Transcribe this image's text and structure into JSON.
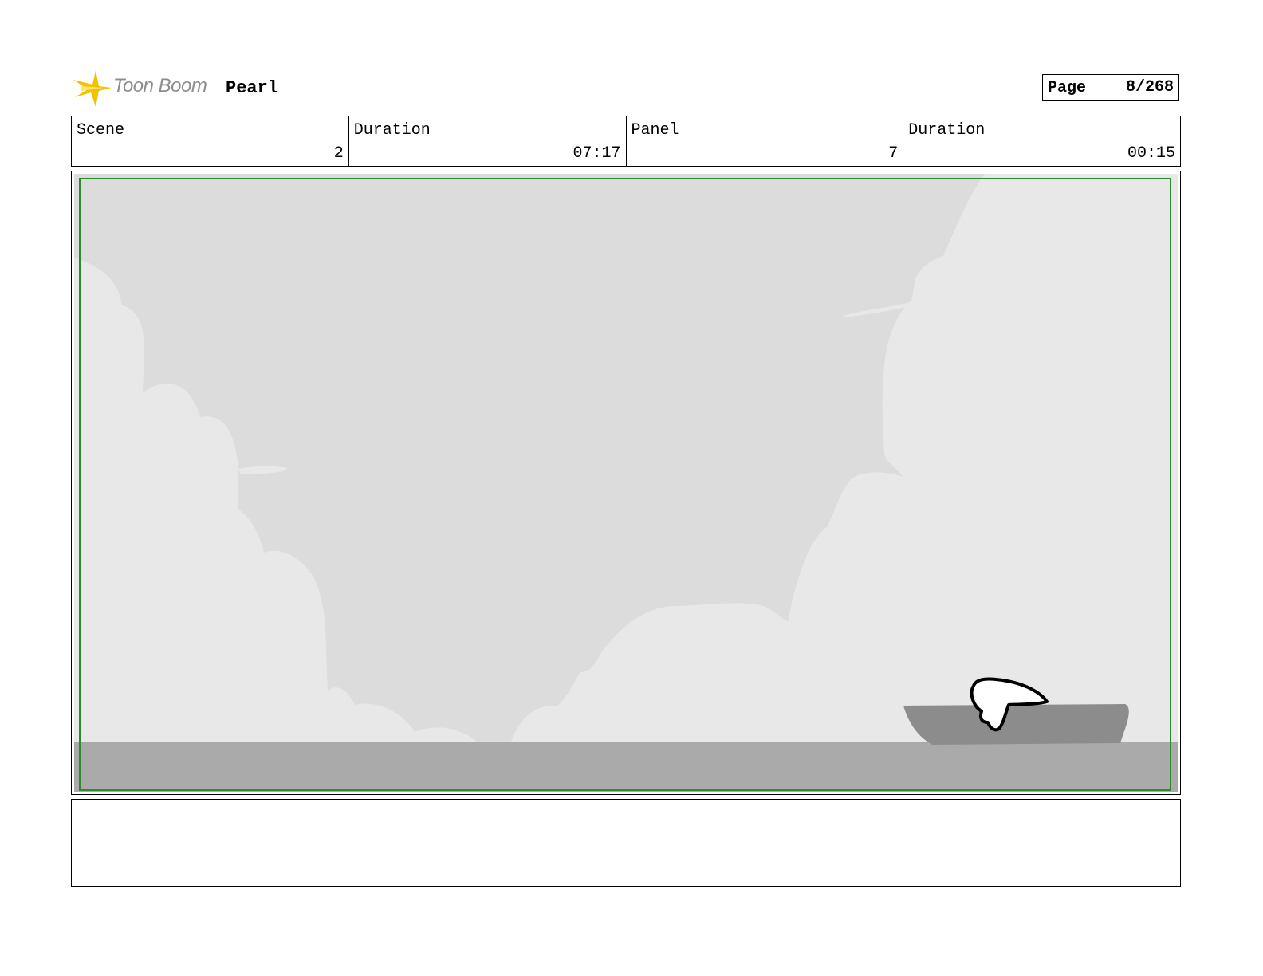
{
  "header": {
    "logo_text": "Toon Boom",
    "project_title": "Pearl",
    "page_label": "Page",
    "page_value": "8/268"
  },
  "info": {
    "scene_label": "Scene",
    "scene_value": "2",
    "scene_duration_label": "Duration",
    "scene_duration_value": "07:17",
    "panel_label": "Panel",
    "panel_value": "7",
    "panel_duration_label": "Duration",
    "panel_duration_value": "00:15"
  },
  "colors": {
    "safe_frame": "#2f8a2f",
    "sky": "#dcdcdc",
    "clouds": "#e8e8e8",
    "sea": "#aaaaaa",
    "boat": "#8c8c8c",
    "logo_star": "#f2c200"
  },
  "notes": {
    "text": ""
  }
}
